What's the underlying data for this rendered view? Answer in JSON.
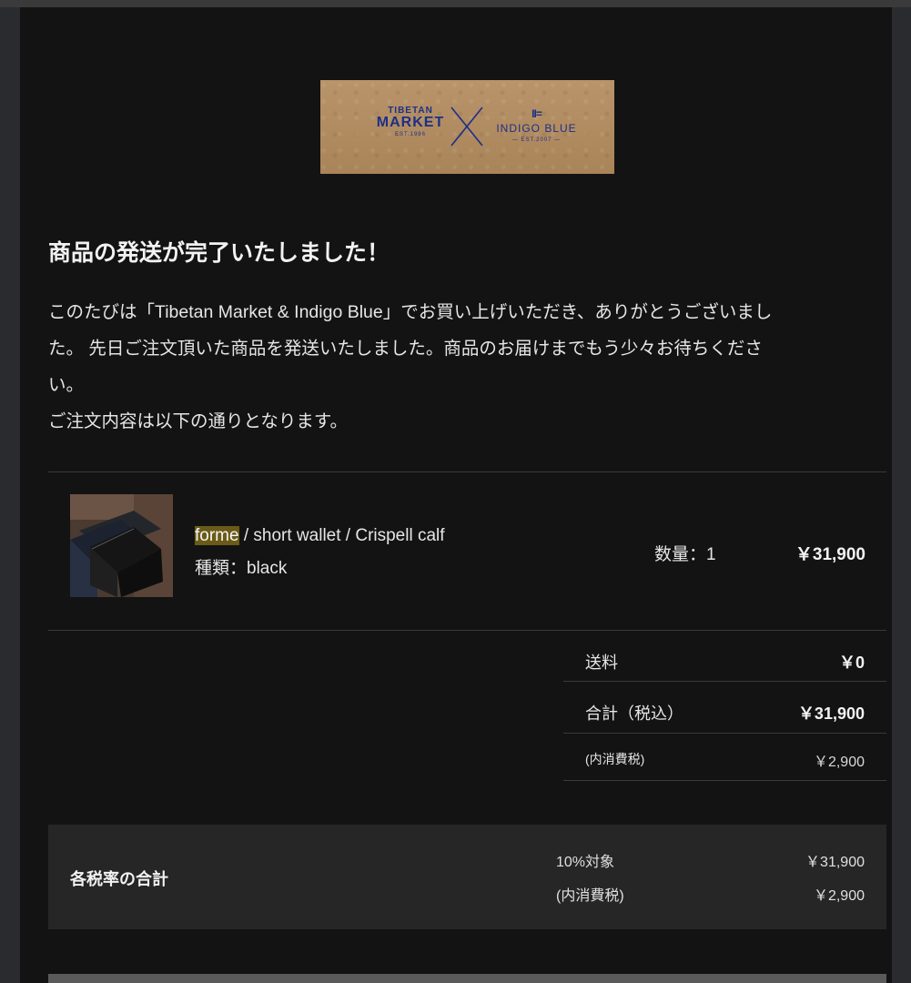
{
  "banner": {
    "tibetan_top": "TIBETAN",
    "tibetan_main": "MARKET",
    "tibetan_est": "EST.1996",
    "indigo_mark": "II=",
    "indigo_name": "INDIGO BLUE",
    "indigo_est": "— EST.2007 —"
  },
  "headline": "商品の発送が完了いたしました！",
  "intro": {
    "line1": "このたびは「Tibetan Market & Indigo Blue」でお買い上げいただき、ありがとうございまし",
    "line2": "た。 先日ご注文頂いた商品を発送いたしました。商品のお届けまでもう少々お待ちくださ",
    "line3": "い。",
    "line4": "ご注文内容は以下の通りとなります。"
  },
  "item": {
    "brand": "forme",
    "name_rest": " / short wallet / Crispell calf",
    "variant": "種類：black",
    "quantity": "数量：1",
    "price": "￥31,900"
  },
  "summary": {
    "shipping_label": "送料",
    "shipping_value": "￥0",
    "total_label": "合計（税込）",
    "total_value": "￥31,900",
    "tax_label": "(内消費税)",
    "tax_value": "￥2,900"
  },
  "tax_box": {
    "title": "各税率の合計",
    "rate_label": "10%対象",
    "rate_value": "￥31,900",
    "tax_label": "(内消費税)",
    "tax_value": "￥2,900"
  }
}
